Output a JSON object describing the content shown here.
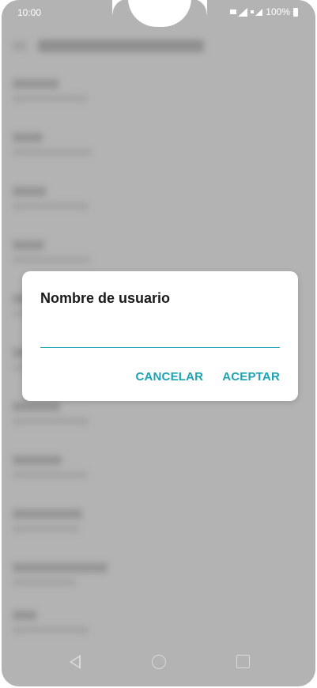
{
  "status_bar": {
    "time": "10:00",
    "battery": "100%"
  },
  "dialog": {
    "title": "Nombre de usuario",
    "input_value": "",
    "buttons": {
      "cancel": "CANCELAR",
      "accept": "ACEPTAR"
    }
  },
  "colors": {
    "accent": "#1aa3b0",
    "scrim": "#b3b3b3",
    "dialog_bg": "#ffffff"
  },
  "nav_bar": {
    "icons": [
      "back-icon",
      "home-icon",
      "recents-icon"
    ]
  }
}
